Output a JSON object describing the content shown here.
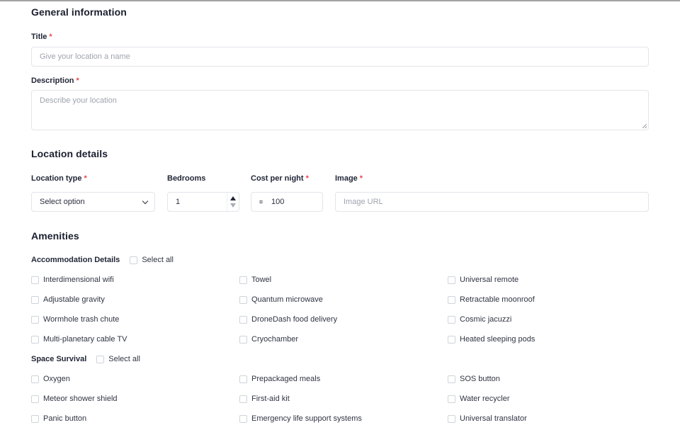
{
  "general": {
    "heading": "General information",
    "title_label": "Title",
    "title_placeholder": "Give your location a name",
    "description_label": "Description",
    "description_placeholder": "Describe your location",
    "required_mark": "*"
  },
  "location": {
    "heading": "Location details",
    "type_label": "Location type",
    "type_value": "Select option",
    "bedrooms_label": "Bedrooms",
    "bedrooms_value": "1",
    "cost_label": "Cost per night",
    "cost_currency_symbol": "¤",
    "cost_value": "100",
    "image_label": "Image",
    "image_placeholder": "Image URL"
  },
  "amenities": {
    "heading": "Amenities",
    "groups": [
      {
        "title": "Accommodation Details",
        "select_all": "Select all",
        "items": [
          "Interdimensional wifi",
          "Towel",
          "Universal remote",
          "Adjustable gravity",
          "Quantum microwave",
          "Retractable moonroof",
          "Wormhole trash chute",
          "DroneDash food delivery",
          "Cosmic jacuzzi",
          "Multi-planetary cable TV",
          "Cryochamber",
          "Heated sleeping pods"
        ]
      },
      {
        "title": "Space Survival",
        "select_all": "Select all",
        "items": [
          "Oxygen",
          "Prepackaged meals",
          "SOS button",
          "Meteor shower shield",
          "First-aid kit",
          "Water recycler",
          "Panic button",
          "Emergency life support systems",
          "Universal translator"
        ]
      }
    ]
  }
}
